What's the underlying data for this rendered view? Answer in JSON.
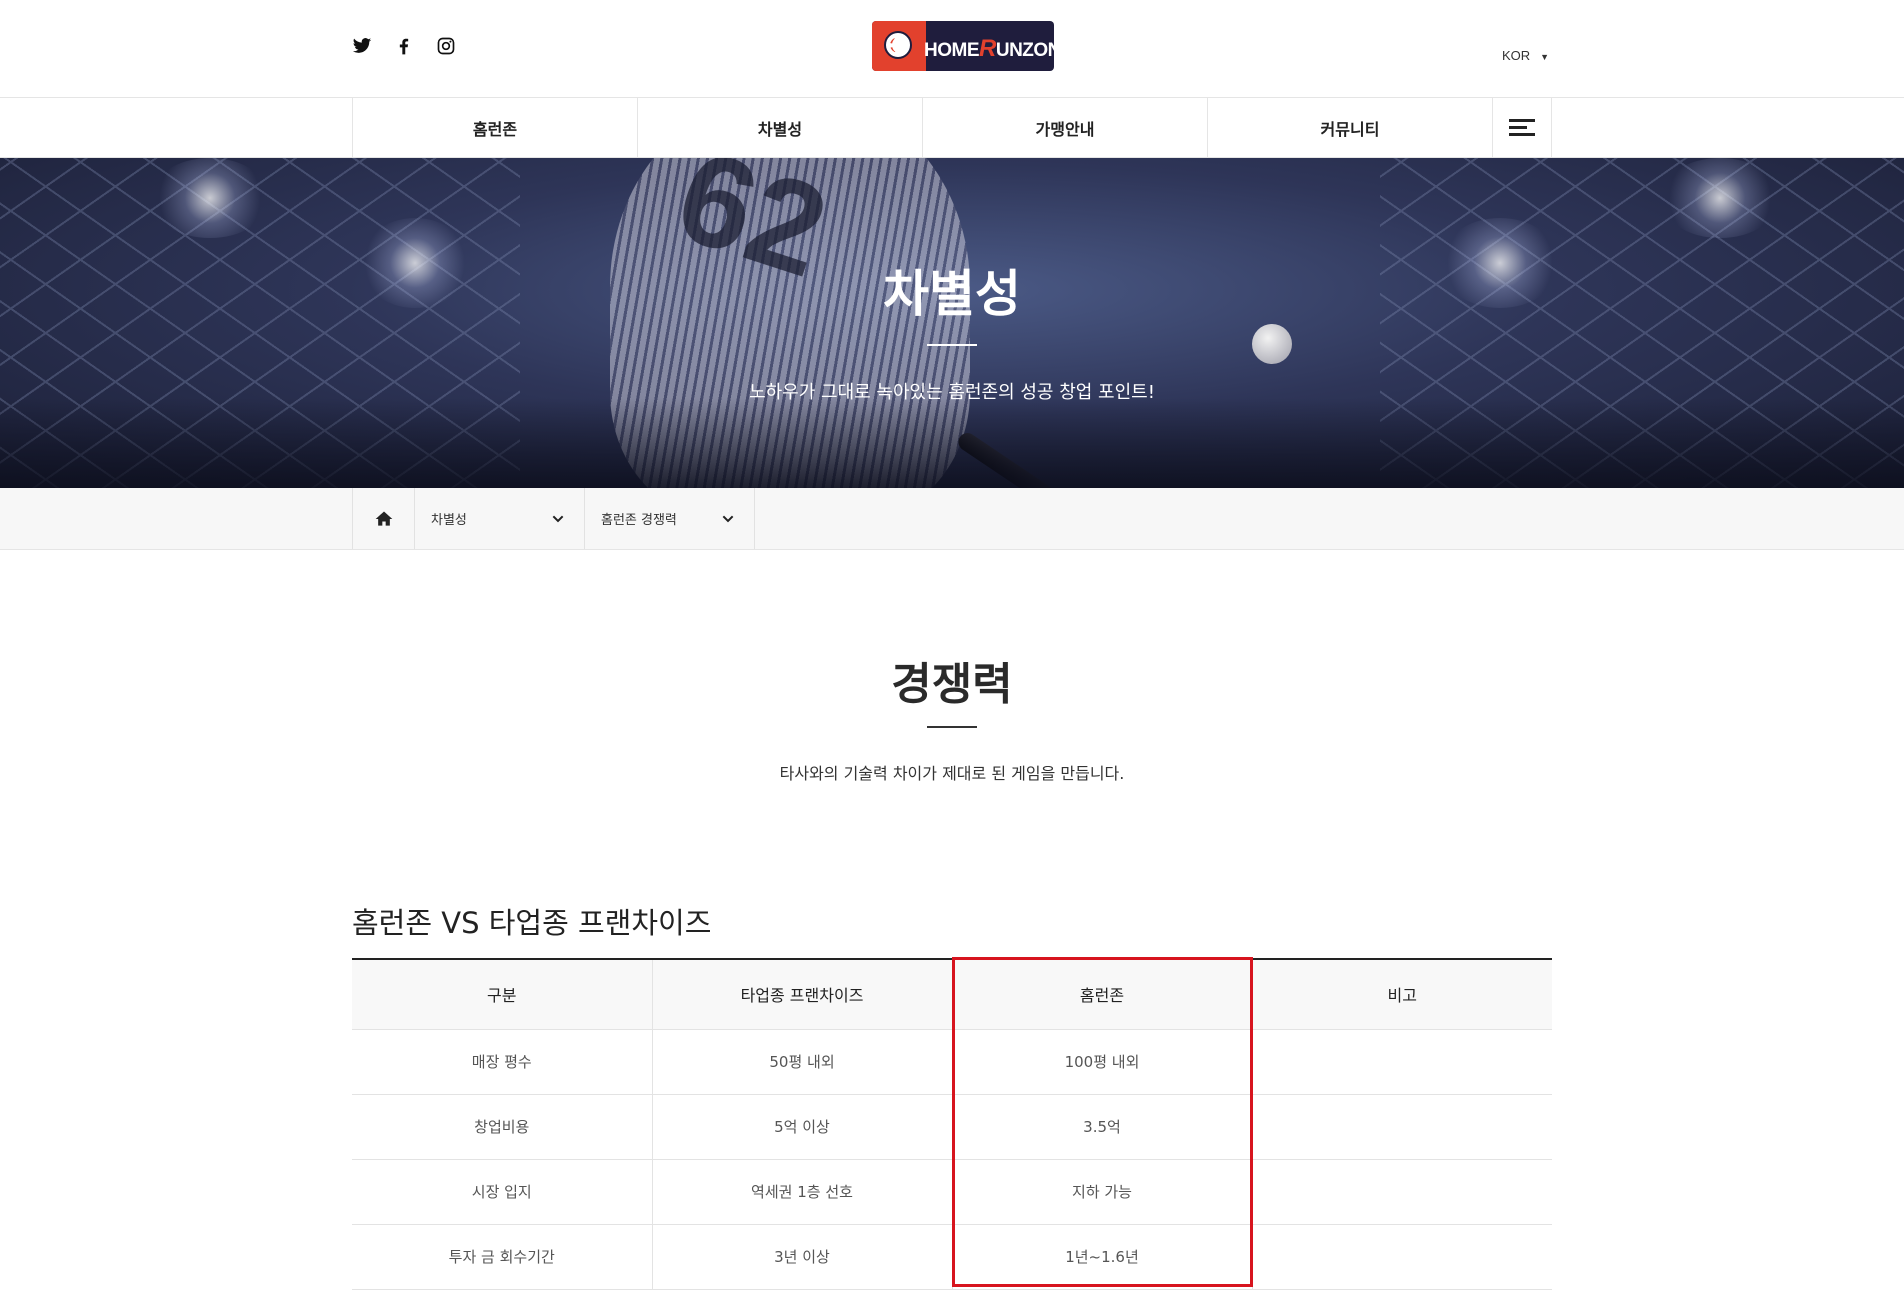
{
  "header": {
    "social_icons": [
      "twitter-icon",
      "facebook-icon",
      "instagram-icon"
    ],
    "logo_text_prefix": "HOME",
    "logo_text_r": "R",
    "logo_text_suffix": "UNZON",
    "language": "KOR"
  },
  "nav": {
    "items": [
      {
        "label": "홈런존"
      },
      {
        "label": "차별성"
      },
      {
        "label": "가맹안내"
      },
      {
        "label": "커뮤니티"
      }
    ],
    "menu_icon": "hamburger-menu-icon"
  },
  "hero": {
    "title": "차별성",
    "subtitle": "노하우가 그대로 녹아있는 홈런존의 성공 창업 포인트!"
  },
  "location": {
    "home_icon": "home-icon",
    "depth1": "차별성",
    "depth2": "홈런존 경쟁력"
  },
  "section": {
    "title": "경쟁력",
    "description": "타사와의 기술력 차이가 제대로 된 게임을 만듭니다."
  },
  "comparison": {
    "title": "홈런존 VS 타업종 프랜차이즈",
    "headers": [
      "구분",
      "타업종 프랜차이즈",
      "홈런존",
      "비고"
    ],
    "rows": [
      [
        "매장 평수",
        "50평 내외",
        "100평 내외",
        ""
      ],
      [
        "창업비용",
        "5억 이상",
        "3.5억",
        ""
      ],
      [
        "시장 입지",
        "역세권 1층 선호",
        "지하 가능",
        ""
      ],
      [
        "투자 금 회수기간",
        "3년 이상",
        "1년~1.6년",
        ""
      ]
    ]
  },
  "colors": {
    "accent_red": "#d7141e",
    "logo_navy": "#1f1d3d",
    "logo_red": "#e2412d"
  }
}
